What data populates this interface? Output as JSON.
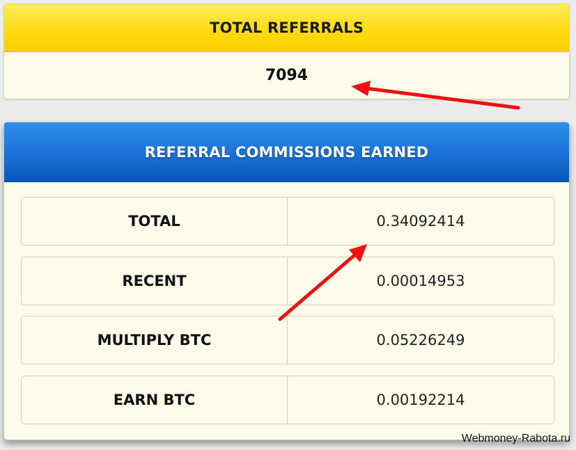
{
  "referrals": {
    "title": "TOTAL REFERRALS",
    "count": "7094"
  },
  "commissions": {
    "title": "REFERRAL COMMISSIONS EARNED",
    "rows": [
      {
        "label": "TOTAL",
        "value": "0.34092414"
      },
      {
        "label": "RECENT",
        "value": "0.00014953"
      },
      {
        "label": "MULTIPLY BTC",
        "value": "0.05226249"
      },
      {
        "label": "EARN BTC",
        "value": "0.00192214"
      }
    ]
  },
  "annotations": {
    "arrow_color": "#ee1111"
  },
  "watermark": "Webmoney-Rabota.ru"
}
